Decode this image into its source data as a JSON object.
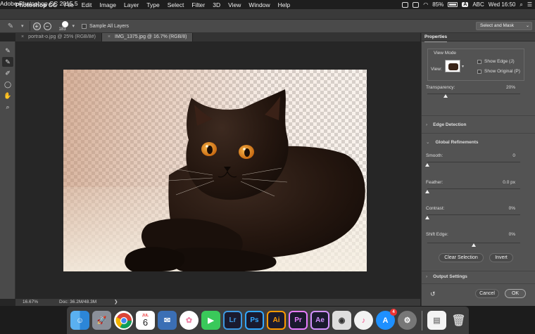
{
  "menubar": {
    "app_name": "Photoshop CC",
    "items": [
      "File",
      "Edit",
      "Image",
      "Layer",
      "Type",
      "Select",
      "Filter",
      "3D",
      "View",
      "Window",
      "Help"
    ],
    "battery": "85%",
    "input_source": "A",
    "input_label": "ABC",
    "clock": "Wed 16:50"
  },
  "window": {
    "title": "Adobe Photoshop CC 2015.5"
  },
  "options": {
    "brush_size": "183",
    "sample_all_layers": "Sample All Layers",
    "select_and_mask": "Select and Mask"
  },
  "tabs": [
    {
      "label": "portrait-o.jpg @ 25% (RGB/8#)",
      "active": false
    },
    {
      "label": "IMG_1375.jpg @ 16.7% (RGB/8)",
      "active": true
    }
  ],
  "status": {
    "zoom": "16.67%",
    "doc": "Doc: 36.2M/48.3M",
    "arrow": "❯"
  },
  "properties": {
    "header": "Properties",
    "view_mode": "View Mode",
    "view_label": "View:",
    "show_edge": "Show Edge (J)",
    "show_original": "Show Original (P)",
    "transparency": {
      "label": "Transparency:",
      "value": "20%",
      "fraction": 0.2
    },
    "edge_detection": "Edge Detection",
    "global_refinements": "Global Refinements",
    "smooth": {
      "label": "Smooth:",
      "value": "0",
      "fraction": 0
    },
    "feather": {
      "label": "Feather:",
      "value": "0.0 px",
      "fraction": 0
    },
    "contrast": {
      "label": "Contrast:",
      "value": "0%",
      "fraction": 0
    },
    "shift_edge": {
      "label": "Shift Edge:",
      "value": "0%",
      "fraction": 0.5
    },
    "clear_selection": "Clear Selection",
    "invert": "Invert",
    "output_settings": "Output Settings",
    "cancel": "Cancel",
    "ok": "OK"
  },
  "dock": {
    "calendar_day": "6",
    "calendar_month": "JUL",
    "lr": "Lr",
    "ps": "Ps",
    "ai": "Ai",
    "pr": "Pr",
    "ae": "Ae",
    "appstore_badge": "4"
  },
  "colors": {
    "lr": "#3d98e0",
    "ps": "#31a8ff",
    "ai": "#ff9a00",
    "pr": "#e77cff",
    "ae": "#d291ff"
  }
}
